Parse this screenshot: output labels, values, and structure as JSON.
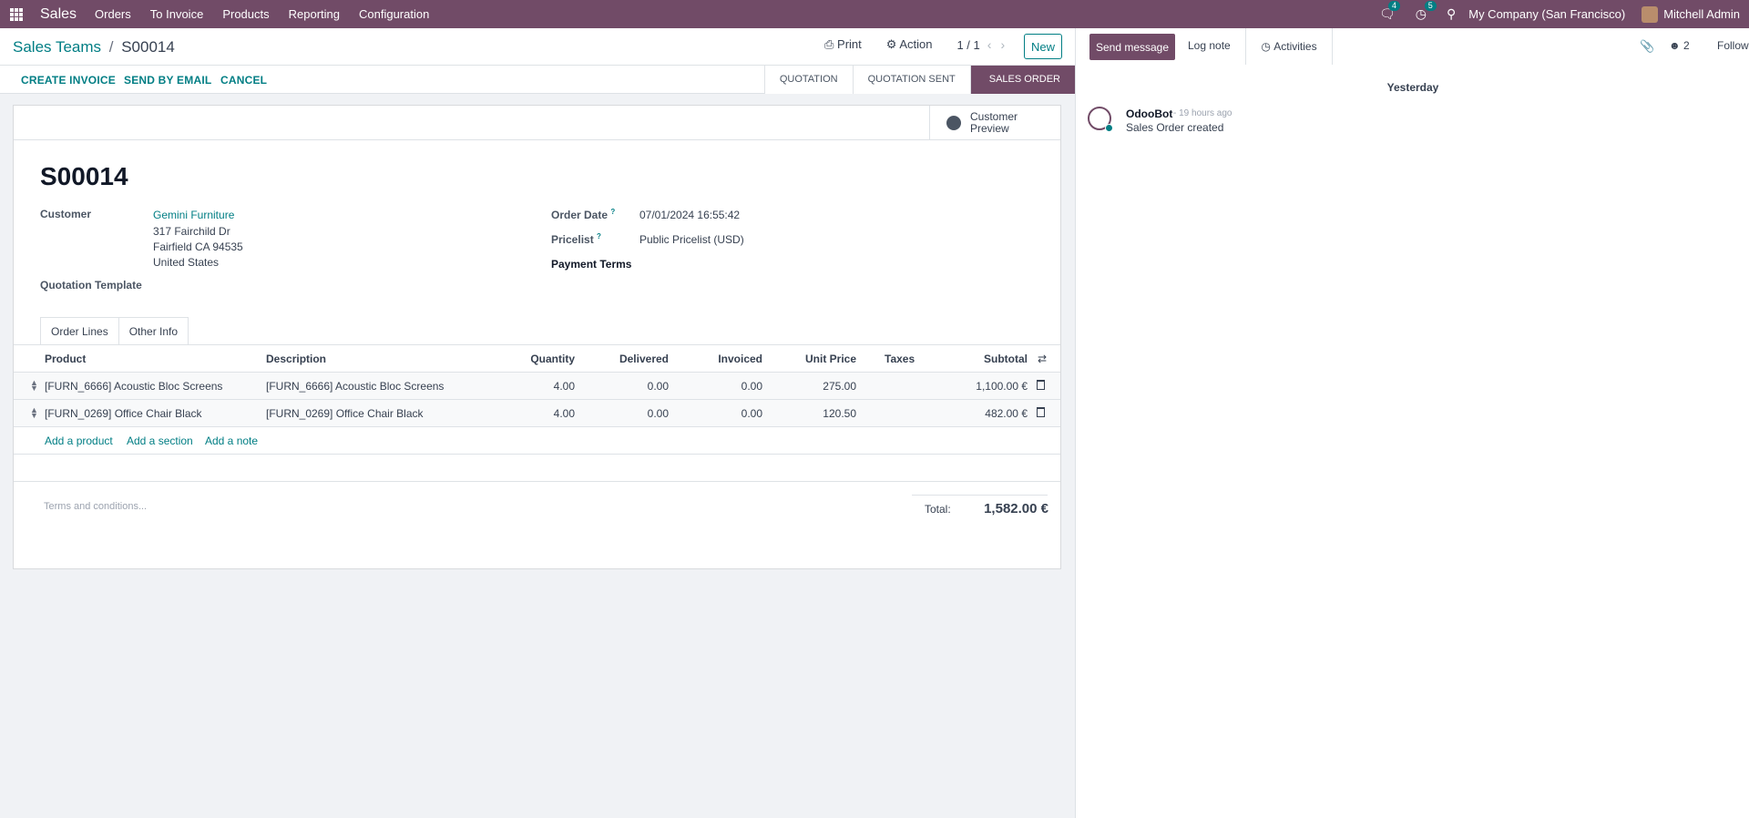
{
  "topbar": {
    "app_name": "Sales",
    "menus": [
      "Orders",
      "To Invoice",
      "Products",
      "Reporting",
      "Configuration"
    ],
    "messages_badge": "4",
    "activities_badge": "5",
    "company": "My Company (San Francisco)",
    "user": "Mitchell Admin"
  },
  "control_panel": {
    "breadcrumb_parent": "Sales Teams",
    "breadcrumb_sep": "/",
    "breadcrumb_current": "S00014",
    "print_label": "Print",
    "action_label": "Action",
    "pager": "1 / 1",
    "new_label": "New"
  },
  "statusbar": {
    "buttons": [
      "CREATE INVOICE",
      "SEND BY EMAIL",
      "CANCEL"
    ],
    "stages": [
      "QUOTATION",
      "QUOTATION SENT",
      "SALES ORDER"
    ],
    "active_stage": "SALES ORDER"
  },
  "form": {
    "preview_label": "Customer Preview",
    "title": "S00014",
    "customer_label": "Customer",
    "customer_name": "Gemini Furniture",
    "address_line1": "317 Fairchild Dr",
    "address_line2": "Fairfield CA 94535",
    "address_line3": "United States",
    "quotation_template_label": "Quotation Template",
    "order_date_label": "Order Date",
    "order_date": "07/01/2024 16:55:42",
    "pricelist_label": "Pricelist",
    "pricelist": "Public Pricelist (USD)",
    "payment_terms_label": "Payment Terms",
    "help_mark": "?",
    "tabs": [
      "Order Lines",
      "Other Info"
    ]
  },
  "order_lines": {
    "columns": {
      "product": "Product",
      "description": "Description",
      "quantity": "Quantity",
      "delivered": "Delivered",
      "invoiced": "Invoiced",
      "unit_price": "Unit Price",
      "taxes": "Taxes",
      "subtotal": "Subtotal"
    },
    "rows": [
      {
        "product": "[FURN_6666] Acoustic Bloc Screens",
        "description": "[FURN_6666] Acoustic Bloc Screens",
        "quantity": "4.00",
        "delivered": "0.00",
        "invoiced": "0.00",
        "unit_price": "275.00",
        "taxes": "",
        "subtotal": "1,100.00 €"
      },
      {
        "product": "[FURN_0269] Office Chair Black",
        "description": "[FURN_0269] Office Chair Black",
        "quantity": "4.00",
        "delivered": "0.00",
        "invoiced": "0.00",
        "unit_price": "120.50",
        "taxes": "",
        "subtotal": "482.00 €"
      }
    ],
    "add_product": "Add a product",
    "add_section": "Add a section",
    "add_note": "Add a note",
    "terms_placeholder": "Terms and conditions...",
    "total_label": "Total:",
    "total_value": "1,582.00 €"
  },
  "chatter": {
    "send_message": "Send message",
    "log_note": "Log note",
    "activities": "Activities",
    "followers_count": "2",
    "follow": "Follow",
    "date_separator": "Yesterday",
    "messages": [
      {
        "author": "OdooBot",
        "time": "- 19 hours ago",
        "body": "Sales Order created"
      }
    ]
  },
  "colors": {
    "brand": "#714b67",
    "link": "#017e84"
  }
}
